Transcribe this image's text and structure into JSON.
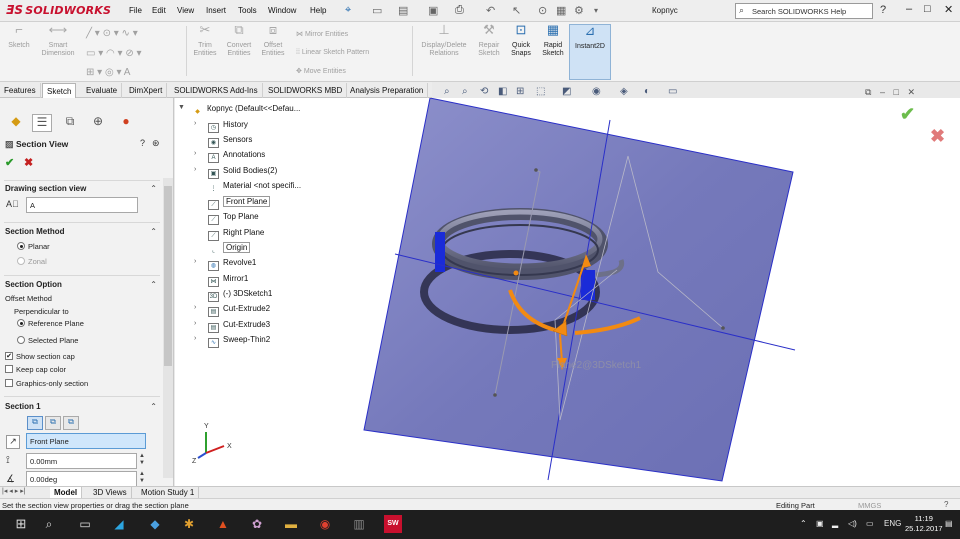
{
  "app": {
    "logo_text": "SOLIDWORKS",
    "menu": [
      "File",
      "Edit",
      "View",
      "Insert",
      "Tools",
      "Window",
      "Help"
    ],
    "doc_title": "Корпус",
    "help_search_placeholder": "Search SOLIDWORKS Help"
  },
  "commands": {
    "sketch": "Sketch",
    "smart_dimension": "Smart\nDimension",
    "trim": "Trim\nEntities",
    "convert": "Convert\nEntities",
    "offset": "Offset\nEntities",
    "mirror": "Mirror Entities",
    "linear_pattern": "Linear Sketch Pattern",
    "move": "Move Entities",
    "display_delete": "Display/Delete\nRelations",
    "repair": "Repair\nSketch",
    "quick_snaps": "Quick\nSnaps",
    "rapid_sketch": "Rapid\nSketch",
    "instant2d": "Instant2D"
  },
  "tabs": [
    "Features",
    "Sketch",
    "Evaluate",
    "DimXpert",
    "SOLIDWORKS Add-Ins",
    "SOLIDWORKS MBD",
    "Analysis Preparation"
  ],
  "selected_tab": "Sketch",
  "property_manager": {
    "title": "Section View",
    "drawing_section_view": "Drawing section view",
    "label_value": "A",
    "section_method": "Section Method",
    "method_planar": "Planar",
    "method_zonal": "Zonal",
    "section_option": "Section Option",
    "offset_method": "Offset Method",
    "perpendicular_to": "Perpendicular to",
    "reference_plane": "Reference Plane",
    "selected_plane": "Selected Plane",
    "show_section_cap": "Show section cap",
    "keep_cap_color": "Keep cap color",
    "graphics_only": "Graphics-only section",
    "section1": "Section 1",
    "plane_value": "Front Plane",
    "distance_value": "0.00mm",
    "angle_value": "0.00deg"
  },
  "tree": {
    "root": "Корпус (Default<<Defau...",
    "items": [
      "History",
      "Sensors",
      "Annotations",
      "Solid Bodies(2)",
      "Material <not specifi...",
      "Front Plane",
      "Top Plane",
      "Right Plane",
      "Origin",
      "Revolve1",
      "Mirror1",
      "(-) 3DSketch1",
      "Cut-Extrude2",
      "Cut-Extrude3",
      "Sweep-Thin2"
    ]
  },
  "viewport": {
    "plane_label": "Plane2@3DSketch1",
    "triad_x": "X",
    "triad_y": "Y",
    "triad_z": "Z"
  },
  "bottom_tabs": [
    "Model",
    "3D Views",
    "Motion Study 1"
  ],
  "status": {
    "message": "Set the section view properties or drag the section plane",
    "mode": "Editing Part",
    "units": "MMGS"
  },
  "taskbar": {
    "lang": "ENG",
    "time": "11:19",
    "date": "25.12.2017"
  },
  "colors": {
    "brand": "#c8102e",
    "plane": "#6f74b8",
    "selection_blue": "#1a2bd8",
    "handle_orange": "#f28a12"
  }
}
